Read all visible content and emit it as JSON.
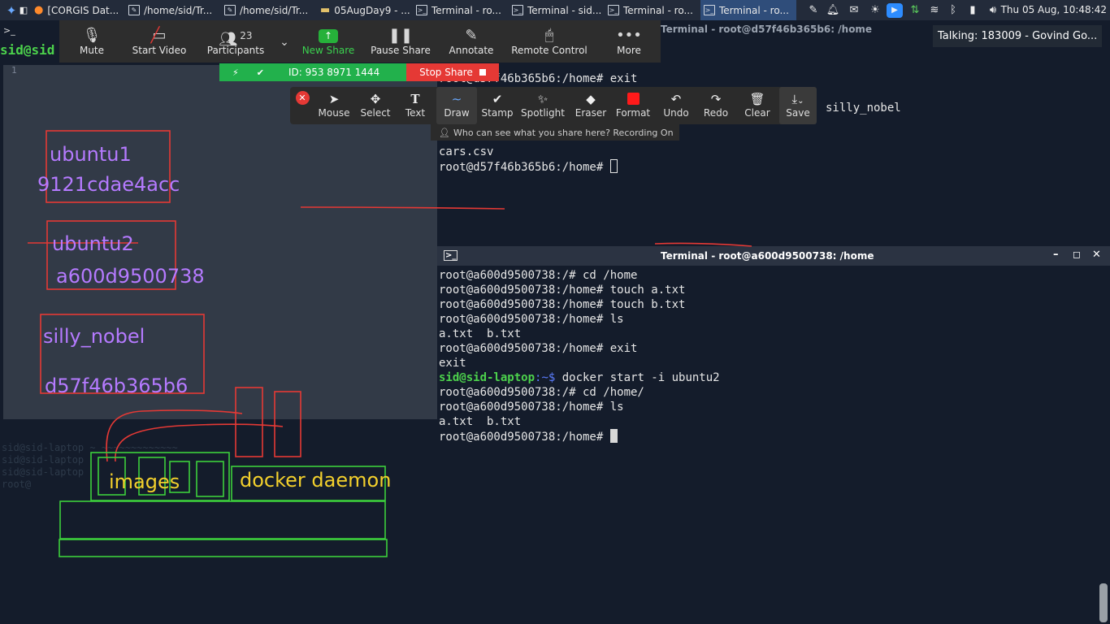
{
  "taskbar": {
    "tasks": [
      {
        "label": "[CORGIS Dat..."
      },
      {
        "label": "/home/sid/Tr..."
      },
      {
        "label": "/home/sid/Tr..."
      },
      {
        "label": "05AugDay9 - ..."
      },
      {
        "label": "Terminal - ro..."
      },
      {
        "label": "Terminal - sid..."
      },
      {
        "label": "Terminal - ro..."
      },
      {
        "label": "Terminal - ro..."
      }
    ],
    "clock": "Thu 05 Aug, 10:48:42"
  },
  "zoom": {
    "mute": "Mute",
    "start_video": "Start Video",
    "participants": "Participants",
    "participants_count": "23",
    "new_share": "New Share",
    "pause_share": "Pause Share",
    "annotate": "Annotate",
    "remote_control": "Remote Control",
    "more": "More",
    "meeting_id": "ID: 953 8971 1444",
    "stop_share": "Stop Share",
    "tooltip": "Talking: 183009 - Govind Go...",
    "who_can_see": "Who can see what you share here? Recording On"
  },
  "annotate_tools": {
    "mouse": "Mouse",
    "select": "Select",
    "text": "Text",
    "draw": "Draw",
    "stamp": "Stamp",
    "spotlight": "Spotlight",
    "eraser": "Eraser",
    "format": "Format",
    "undo": "Undo",
    "redo": "Redo",
    "clear": "Clear",
    "save": "Save"
  },
  "left_window": {
    "prompt": "sid@sid",
    "line_number": "1"
  },
  "whiteboard": {
    "ubuntu1": "ubuntu1",
    "ubuntu1_id": "9121cdae4acc",
    "ubuntu2": "ubuntu2",
    "ubuntu2_id": "a600d9500738",
    "silly_nobel": "silly_nobel",
    "silly_nobel_id": "d57f46b365b6",
    "images": "images",
    "docker_daemon": "docker daemon"
  },
  "terminal1": {
    "title": "Terminal - root@d57f46b365b6: /home",
    "lines": [
      "root@d57f46b365b6:/home# exit",
      "silly_nobel",
      "cars.csv",
      "root@d57f46b365b6:/home# "
    ]
  },
  "terminal2": {
    "title": "Terminal - root@a600d9500738: /home",
    "lines": [
      "root@a600d9500738:/# cd /home",
      "root@a600d9500738:/home# touch a.txt",
      "root@a600d9500738:/home# touch b.txt",
      "root@a600d9500738:/home# ls",
      "a.txt  b.txt",
      "root@a600d9500738:/home# exit",
      "exit",
      "root@a600d9500738:/# cd /home/",
      "root@a600d9500738:/home# ls",
      "a.txt  b.txt",
      "root@a600d9500738:/home# "
    ],
    "sid_user": "sid@sid-laptop",
    "sid_path": ":~$ ",
    "sid_cmd": "docker start -i ubuntu2"
  },
  "colors": {
    "annotation_red": "#e53935",
    "annotation_green": "#3ccf3c",
    "annotation_purple": "#b57aff",
    "annotation_yellow": "#f3d02c"
  }
}
